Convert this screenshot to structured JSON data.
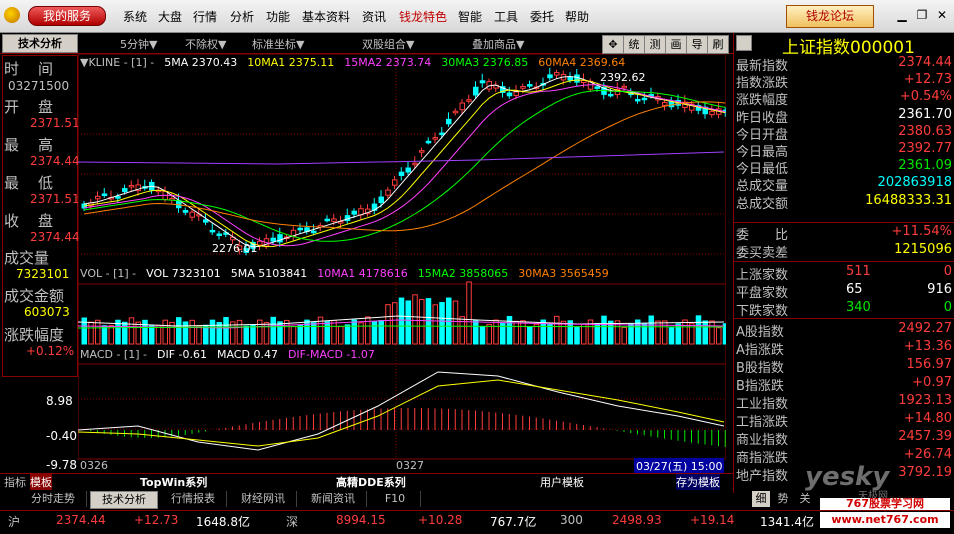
{
  "menu": {
    "service_label": "我的服务",
    "items": [
      "系统",
      "大盘",
      "行情",
      "分析",
      "功能",
      "基本资料",
      "资讯",
      "钱龙特色",
      "智能",
      "工具",
      "委托",
      "帮助"
    ],
    "forum_label": "钱龙论坛"
  },
  "toolbar": {
    "tab_label": "技术分析",
    "period": "5分钟▼",
    "rights": "不除权▼",
    "coord": "标准坐标▼",
    "combo": "双股组合▼",
    "overlay": "叠加商品▼",
    "icons": [
      "✥",
      "统",
      "测",
      "画",
      "导",
      "刷"
    ]
  },
  "left_panel": {
    "time_label": "时　间",
    "time_value": "03271500",
    "open_label": "开　盘",
    "open_value": "2371.51",
    "high_label": "最　高",
    "high_value": "2374.44",
    "low_label": "最　低",
    "low_value": "2371.51",
    "close_label": "收　盘",
    "close_value": "2374.44",
    "volume_label": "成交量",
    "volume_value": "7323101",
    "amount_label": "成交金额",
    "amount_value": "603073",
    "change_label": "涨跌幅度",
    "change_value": "+0.12%"
  },
  "kline": {
    "header_name": "▼KLINE - [1] -",
    "ma": [
      {
        "label": "5MA 2370.43",
        "color": "#ffffff"
      },
      {
        "label": "10MA1 2375.11",
        "color": "#ffff00"
      },
      {
        "label": "15MA2 2373.74",
        "color": "#ff40ff"
      },
      {
        "label": "30MA3 2376.85",
        "color": "#00ff00"
      },
      {
        "label": "60MA4 2369.64",
        "color": "#ff8000"
      }
    ],
    "high_mark": "2392.62",
    "low_mark": "2276.01"
  },
  "volume": {
    "header_name": "VOL - [1] -",
    "items": [
      {
        "label": "VOL 7323101",
        "color": "#ffffff"
      },
      {
        "label": "5MA 5103841",
        "color": "#ffffff"
      },
      {
        "label": "10MA1 4178616",
        "color": "#ff40ff"
      },
      {
        "label": "15MA2 3858065",
        "color": "#00ff00"
      },
      {
        "label": "30MA3 3565459",
        "color": "#ff8000"
      }
    ]
  },
  "macd": {
    "header_name": "MACD - [1] -",
    "items": [
      {
        "label": "DIF -0.61",
        "color": "#ffffff"
      },
      {
        "label": "MACD 0.47",
        "color": "#ffffff"
      },
      {
        "label": "DIF-MACD -1.07",
        "color": "#ff40ff"
      }
    ],
    "axis": [
      "8.98",
      "-0.40",
      "-9.78"
    ]
  },
  "xaxis": {
    "labels": [
      "0326",
      "0327"
    ],
    "cursor_time": "03/27(五) 15:00"
  },
  "right_panel": {
    "title": "上证指数000001",
    "quote": [
      {
        "k": "最新指数",
        "v": "2374.44",
        "c": "red"
      },
      {
        "k": "指数涨跌",
        "v": "+12.73",
        "c": "red"
      },
      {
        "k": "涨跌幅度",
        "v": "+0.54%",
        "c": "red"
      },
      {
        "k": "昨日收盘",
        "v": "2361.70",
        "c": "wht"
      },
      {
        "k": "今日开盘",
        "v": "2380.63",
        "c": "red"
      },
      {
        "k": "今日最高",
        "v": "2392.77",
        "c": "red"
      },
      {
        "k": "今日最低",
        "v": "2361.09",
        "c": "grn"
      },
      {
        "k": "总成交量",
        "v": "202863918",
        "c": "cyn"
      },
      {
        "k": "总成交额",
        "v": "16488333.31",
        "c": "yel"
      }
    ],
    "ratio": [
      {
        "k": "委　　比",
        "v": "+11.54%",
        "c": "red"
      },
      {
        "k": "委买卖差",
        "v": "1215096",
        "c": "yel"
      }
    ],
    "breadth": [
      {
        "k": "上涨家数",
        "a": "511",
        "b": "0",
        "c": "red"
      },
      {
        "k": "平盘家数",
        "a": "65",
        "b": "916",
        "c": "wht"
      },
      {
        "k": "下跌家数",
        "a": "340",
        "b": "0",
        "c": "grn"
      }
    ],
    "sectors": [
      {
        "k": "A股指数",
        "v": "2492.27",
        "c": "red"
      },
      {
        "k": "A指涨跌",
        "v": "+13.36",
        "c": "red"
      },
      {
        "k": "B股指数",
        "v": "156.97",
        "c": "red"
      },
      {
        "k": "B指涨跌",
        "v": "+0.97",
        "c": "red"
      },
      {
        "k": "工业指数",
        "v": "1923.13",
        "c": "red"
      },
      {
        "k": "工指涨跌",
        "v": "+14.80",
        "c": "red"
      },
      {
        "k": "商业指数",
        "v": "2457.39",
        "c": "red"
      },
      {
        "k": "商指涨跌",
        "v": "+26.74",
        "c": "red"
      },
      {
        "k": "地产指数",
        "v": "3792.19",
        "c": "red"
      }
    ],
    "bottom_tabs": [
      "细",
      "势",
      "关"
    ]
  },
  "subtabs": {
    "indicator": "指标",
    "template": "模板",
    "items": [
      "TopWin系列",
      "高精DDE系列",
      "用户模板",
      "存为模板"
    ]
  },
  "tabs": [
    "分时走势",
    "技术分析",
    "行情报表",
    "财经网讯",
    "新闻资讯",
    "F10"
  ],
  "status": [
    {
      "name": "沪",
      "price": "2374.44",
      "chg": "+12.73",
      "amt": "1648.8亿"
    },
    {
      "name": "深",
      "price": "8994.15",
      "chg": "+10.28",
      "amt": "767.7亿"
    },
    {
      "name": "300",
      "price": "2498.93",
      "chg": "+19.14",
      "amt": "1341.4亿"
    }
  ],
  "watermark": {
    "brand": "yesky",
    "sub": "天极网",
    "site": "767股票学习网",
    "url": "www.net767.com"
  }
}
